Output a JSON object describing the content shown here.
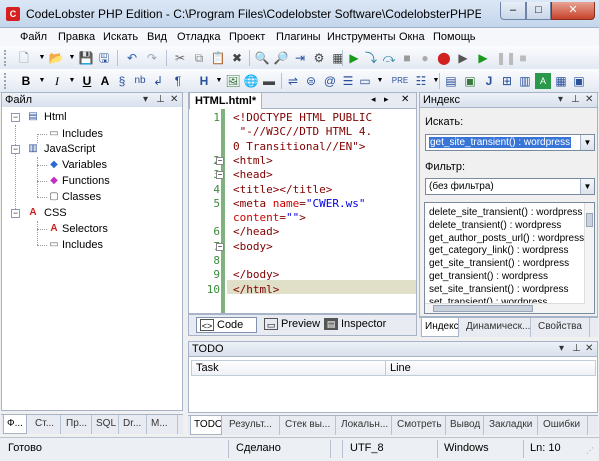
{
  "window": {
    "title": "CodeLobster PHP Edition - C:\\Program Files\\Codelobster Software\\CodelobsterPHPEdition\\Data\\Templates\\H...",
    "app_icon_text": "C",
    "min_glyph": "–",
    "max_glyph": "□",
    "close_glyph": "✕"
  },
  "menu": [
    "Файл",
    "Правка",
    "Искать",
    "Вид",
    "Отладка",
    "Проект",
    "Плагины",
    "Инструменты",
    "Окна",
    "Помощь"
  ],
  "file_panel": {
    "title": "Файл",
    "tree": {
      "html": "Html",
      "html_includes": "Includes",
      "javascript": "JavaScript",
      "js_variables": "Variables",
      "js_functions": "Functions",
      "js_classes": "Classes",
      "css": "CSS",
      "css_selectors": "Selectors",
      "css_includes": "Includes"
    },
    "tabs": [
      "Ф...",
      "Ст...",
      "Пр...",
      "SQL",
      "Dr...",
      "М..."
    ]
  },
  "editor": {
    "tab_title": "HTML.html*",
    "lines": [
      {
        "n": "1",
        "html": "<span class=\"doc\">&lt;!DOCTYPE HTML PUBLIC</span>"
      },
      {
        "n": "",
        "html": "<span class=\"doc\"> \"-//W3C//DTD HTML 4.</span>"
      },
      {
        "n": "",
        "html": "<span class=\"doc\">0 Transitional//EN\"&gt;</span>"
      },
      {
        "n": "2",
        "html": "<span class=\"tag\">&lt;html&gt;</span>"
      },
      {
        "n": "3",
        "html": "<span class=\"tag\">&lt;head&gt;</span>"
      },
      {
        "n": "4",
        "html": "<span class=\"tag\">&lt;title&gt;&lt;/title&gt;</span>"
      },
      {
        "n": "5",
        "html": "<span class=\"tag\">&lt;meta </span><span class=\"attr\">name</span><span class=\"tag\">=</span><span class=\"str\">\"CWER.ws\"</span>"
      },
      {
        "n": "",
        "html": "<span class=\"attr\">content</span><span class=\"tag\">=</span><span class=\"str\">\"\"</span><span class=\"tag\">&gt;</span>"
      },
      {
        "n": "6",
        "html": "<span class=\"tag\">&lt;/head&gt;</span>"
      },
      {
        "n": "7",
        "html": "<span class=\"tag\">&lt;body&gt;</span>"
      },
      {
        "n": "8",
        "html": ""
      },
      {
        "n": "9",
        "html": "<span class=\"tag\">&lt;/body&gt;</span>"
      },
      {
        "n": "10",
        "html": "<span class=\"tag\">&lt;/html&gt;</span>"
      }
    ],
    "view_tabs": [
      "Code",
      "Preview",
      "Inspector"
    ]
  },
  "index_panel": {
    "title": "Индекс",
    "search_label": "Искать:",
    "search_value": "get_site_transient() : wordpress",
    "filter_label": "Фильтр:",
    "filter_value": "(без фильтра)",
    "items": [
      "delete_site_transient() : wordpress",
      "delete_transient() : wordpress",
      "get_author_posts_url() : wordpress",
      "get_category_link() : wordpress",
      "get_site_transient() : wordpress",
      "get_transient() : wordpress",
      "set_site_transient() : wordpress",
      "set_transient() : wordpress"
    ],
    "tabs": [
      "Индекс",
      "Динамическ...",
      "Свойства"
    ]
  },
  "todo": {
    "title": "TODO",
    "columns": [
      "Task",
      "Line"
    ],
    "tabs": [
      "TODO",
      "Результ...",
      "Стек вы...",
      "Локальн...",
      "Смотреть",
      "Вывод",
      "Закладки",
      "Ошибки"
    ]
  },
  "status": {
    "ready": "Готово",
    "done": "Сделано",
    "encoding": "UTF_8",
    "eol": "Windows",
    "position": "Ln: 10"
  }
}
